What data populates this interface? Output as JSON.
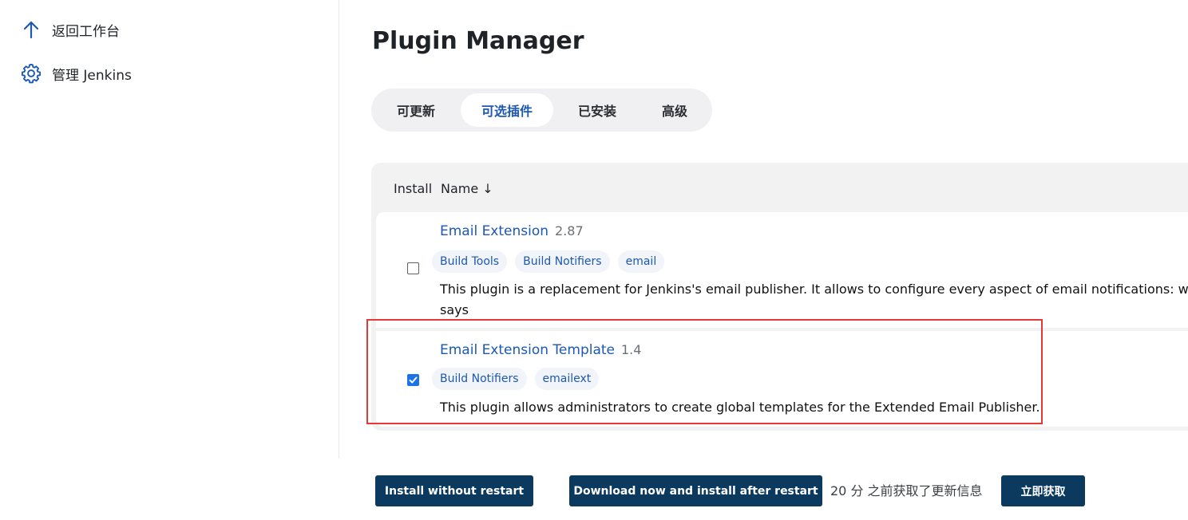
{
  "sidebar": {
    "back": {
      "label": "返回工作台",
      "icon": "arrow-up-icon"
    },
    "manage": {
      "label": "管理 Jenkins",
      "icon": "gear-icon"
    }
  },
  "page": {
    "title": "Plugin Manager"
  },
  "tabs": [
    {
      "label": "可更新",
      "active": false
    },
    {
      "label": "可选插件",
      "active": true
    },
    {
      "label": "已安装",
      "active": false
    },
    {
      "label": "高级",
      "active": false
    }
  ],
  "table": {
    "headers": {
      "install": "Install",
      "name": "Name ↓"
    },
    "rows": [
      {
        "name": "Email Extension",
        "version": "2.87",
        "checked": false,
        "tags": [
          "Build Tools",
          "Build Notifiers",
          "email"
        ],
        "description": "This plugin is a replacement for Jenkins's email publisher. It allows to configure every aspect of email notifications: whe says"
      },
      {
        "name": "Email Extension Template",
        "version": "1.4",
        "checked": true,
        "tags": [
          "Build Notifiers",
          "emailext"
        ],
        "description": "This plugin allows administrators to create global templates for the Extended Email Publisher."
      }
    ]
  },
  "bottom": {
    "install_button": "Install without restart",
    "download_button": "Download now and install after restart",
    "update_info": "20 分 之前获取了更新信息",
    "fetch_button": "立即获取"
  },
  "colors": {
    "accent": "#1c58b4",
    "button_bg": "#0b3a5e",
    "highlight": "#e53935",
    "checkbox_checked": "#1a73e8"
  }
}
